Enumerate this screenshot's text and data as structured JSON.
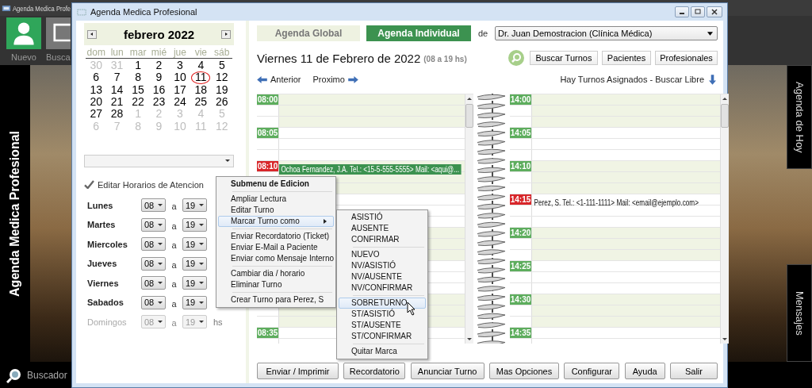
{
  "desktop": {
    "app_title": "Agenda Medica Profe",
    "tiles": [
      {
        "label": "Nuevo",
        "kind": "person"
      },
      {
        "label": "Busca",
        "kind": "screen"
      }
    ],
    "side_title": "Agenda Medica Profesional",
    "search_label": "Buscador",
    "side_tabs": [
      "Agenda de Hoy",
      "Mensajes"
    ]
  },
  "window": {
    "title": "Agenda Medica Profesional"
  },
  "calendar": {
    "month": "febrero 2022",
    "weekdays": [
      "dom",
      "lun",
      "mar",
      "mié",
      "jue",
      "vie",
      "sáb"
    ],
    "days": [
      {
        "day": "30",
        "other_month": true,
        "selected": false
      },
      {
        "day": "31",
        "other_month": true,
        "selected": false
      },
      {
        "day": "1",
        "other_month": false,
        "selected": false
      },
      {
        "day": "2",
        "other_month": false,
        "selected": false
      },
      {
        "day": "3",
        "other_month": false,
        "selected": false
      },
      {
        "day": "4",
        "other_month": false,
        "selected": false
      },
      {
        "day": "5",
        "other_month": false,
        "selected": false
      },
      {
        "day": "6",
        "other_month": false,
        "selected": false
      },
      {
        "day": "7",
        "other_month": false,
        "selected": false
      },
      {
        "day": "8",
        "other_month": false,
        "selected": false
      },
      {
        "day": "9",
        "other_month": false,
        "selected": false
      },
      {
        "day": "10",
        "other_month": false,
        "selected": false
      },
      {
        "day": "11",
        "other_month": false,
        "selected": true
      },
      {
        "day": "12",
        "other_month": false,
        "selected": false
      },
      {
        "day": "13",
        "other_month": false,
        "selected": false
      },
      {
        "day": "14",
        "other_month": false,
        "selected": false
      },
      {
        "day": "15",
        "other_month": false,
        "selected": false
      },
      {
        "day": "16",
        "other_month": false,
        "selected": false
      },
      {
        "day": "17",
        "other_month": false,
        "selected": false
      },
      {
        "day": "18",
        "other_month": false,
        "selected": false
      },
      {
        "day": "19",
        "other_month": false,
        "selected": false
      },
      {
        "day": "20",
        "other_month": false,
        "selected": false
      },
      {
        "day": "21",
        "other_month": false,
        "selected": false
      },
      {
        "day": "22",
        "other_month": false,
        "selected": false
      },
      {
        "day": "23",
        "other_month": false,
        "selected": false
      },
      {
        "day": "24",
        "other_month": false,
        "selected": false
      },
      {
        "day": "25",
        "other_month": false,
        "selected": false
      },
      {
        "day": "26",
        "other_month": false,
        "selected": false
      },
      {
        "day": "27",
        "other_month": false,
        "selected": false
      },
      {
        "day": "28",
        "other_month": false,
        "selected": false
      },
      {
        "day": "1",
        "other_month": true,
        "selected": false
      },
      {
        "day": "2",
        "other_month": true,
        "selected": false
      },
      {
        "day": "3",
        "other_month": true,
        "selected": false
      },
      {
        "day": "4",
        "other_month": true,
        "selected": false
      },
      {
        "day": "5",
        "other_month": true,
        "selected": false
      },
      {
        "day": "6",
        "other_month": true,
        "selected": false
      },
      {
        "day": "7",
        "other_month": true,
        "selected": false
      },
      {
        "day": "8",
        "other_month": true,
        "selected": false
      },
      {
        "day": "9",
        "other_month": true,
        "selected": false
      },
      {
        "day": "10",
        "other_month": true,
        "selected": false
      },
      {
        "day": "11",
        "other_month": true,
        "selected": false
      },
      {
        "day": "12",
        "other_month": true,
        "selected": false
      }
    ]
  },
  "hours_editor": {
    "label": "Editar Horarios de Atencion",
    "days": [
      {
        "name": "Lunes",
        "from": "08",
        "joiner": "a",
        "to": "19",
        "disabled": false
      },
      {
        "name": "Martes",
        "from": "08",
        "joiner": "a",
        "to": "19",
        "disabled": false
      },
      {
        "name": "Miercoles",
        "from": "08",
        "joiner": "a",
        "to": "19",
        "disabled": false
      },
      {
        "name": "Jueves",
        "from": "08",
        "joiner": "a",
        "to": "19",
        "disabled": false
      },
      {
        "name": "Viernes",
        "from": "08",
        "joiner": "a",
        "to": "19",
        "disabled": false
      },
      {
        "name": "Sabados",
        "from": "08",
        "joiner": "a",
        "to": "19",
        "disabled": false
      },
      {
        "name": "Domingos",
        "from": "08",
        "joiner": "a",
        "to": "19",
        "unit": "hs",
        "disabled": true
      }
    ]
  },
  "tabs": [
    {
      "label": "Agenda Global",
      "selected": false
    },
    {
      "label": "Agenda Individual",
      "selected": true
    }
  ],
  "doctor": {
    "label": "de",
    "value": "Dr. Juan Demostracion (Clínica Médica)"
  },
  "date_heading": "Viernes 11 de Febrero de 2022",
  "hours_note": "(08 a 19 hs)",
  "actions": [
    "Buscar Turnos",
    "Pacientes",
    "Profesionales"
  ],
  "nav": {
    "prev": "Anterior",
    "next": "Proximo",
    "status": "Hay Turnos Asignados - Buscar Libre"
  },
  "columns": [
    {
      "slots": [
        {
          "time": "08:00",
          "booked": false
        },
        {
          "time": "08:05",
          "booked": false
        },
        {
          "time": "08:10",
          "booked": true,
          "appointment": {
            "text": "Ochoa Fernandez, J.A. Tel.: <15-5-555-5555> Mail: <aqui@...",
            "highlighted": true
          }
        },
        {
          "time": "08:35",
          "booked": false
        }
      ]
    },
    {
      "slots": [
        {
          "time": "14:00",
          "booked": false
        },
        {
          "time": "14:05",
          "booked": false
        },
        {
          "time": "14:10",
          "booked": false
        },
        {
          "time": "14:15",
          "booked": true,
          "appointment": {
            "text": "Perez, S. Tel.: <1-111-1111> Mail: <email@ejemplo.com>",
            "highlighted": false
          }
        },
        {
          "time": "14:20",
          "booked": false
        },
        {
          "time": "14:25",
          "booked": false
        },
        {
          "time": "14:30",
          "booked": false
        },
        {
          "time": "14:35",
          "booked": false
        }
      ]
    }
  ],
  "context_menu": [
    [
      {
        "label": "Submenu de Edicion",
        "kind": "header",
        "selected": false
      }
    ],
    [
      {
        "label": "Ampliar Lectura",
        "kind": "action",
        "selected": false
      },
      {
        "label": "Editar Turno",
        "kind": "action",
        "selected": false
      },
      {
        "label": "Marcar Turno como",
        "kind": "submenu",
        "selected": true
      }
    ],
    [
      {
        "label": "Enviar Recordatorio (Ticket)",
        "kind": "action",
        "selected": false
      },
      {
        "label": "Enviar E-Mail a Paciente",
        "kind": "action",
        "selected": false
      },
      {
        "label": "Enviar como Mensaje Interno",
        "kind": "action",
        "selected": false
      }
    ],
    [
      {
        "label": "Cambiar dia / horario",
        "kind": "action",
        "selected": false
      },
      {
        "label": "Eliminar Turno",
        "kind": "action",
        "selected": false
      }
    ],
    [
      {
        "label": "Crear Turno para Perez, S",
        "kind": "action",
        "selected": false
      }
    ]
  ],
  "submenu": [
    [
      {
        "label": "ASISTIÓ",
        "selected": false
      },
      {
        "label": "AUSENTE",
        "selected": false
      },
      {
        "label": "CONFIRMAR",
        "selected": false
      }
    ],
    [
      {
        "label": "NUEVO",
        "selected": false
      },
      {
        "label": "NV/ASISTIÓ",
        "selected": false
      },
      {
        "label": "NV/AUSENTE",
        "selected": false
      },
      {
        "label": "NV/CONFIRMAR",
        "selected": false
      }
    ],
    [
      {
        "label": "SOBRETURNO",
        "selected": true
      },
      {
        "label": "ST/ASISTIÓ",
        "selected": false
      },
      {
        "label": "ST/AUSENTE",
        "selected": false
      },
      {
        "label": "ST/CONFIRMAR",
        "selected": false
      }
    ],
    [
      {
        "label": "Quitar Marca",
        "selected": false
      }
    ]
  ],
  "buttons": [
    "Enviar / Imprimir",
    "Recordatorio",
    "Anunciar Turno",
    "Mas Opciones",
    "Configurar",
    "Ayuda",
    "Salir"
  ]
}
